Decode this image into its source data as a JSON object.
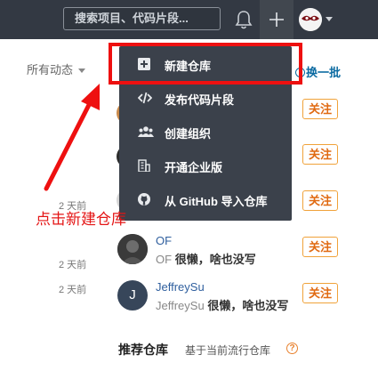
{
  "header": {
    "search_placeholder": "搜索项目、代码片段...",
    "icons": [
      "bell-icon",
      "plus-icon",
      "user-avatar",
      "chevron-down-icon"
    ],
    "colors": {
      "background": "#333943",
      "active_button": "#41474f"
    }
  },
  "feed": {
    "filter_label": "所有动态",
    "refresh_label": "换一批",
    "follow_label": "关注",
    "times": [
      "2 天前",
      "2 天前",
      "2 天前"
    ],
    "users": [
      {
        "name": "OF",
        "bio_name": "OF",
        "bio_text": "很懒，啥也没写"
      },
      {
        "name": "JeffreySu",
        "bio_name": "JeffreySu",
        "bio_text": "很懒，啥也没写",
        "initial": "J"
      }
    ]
  },
  "dropdown_menu": {
    "items": [
      {
        "label": "新建仓库",
        "icon": "plus-square-icon"
      },
      {
        "label": "发布代码片段",
        "icon": "code-icon"
      },
      {
        "label": "创建组织",
        "icon": "group-icon"
      },
      {
        "label": "开通企业版",
        "icon": "building-icon"
      },
      {
        "label": "从 GitHub 导入仓库",
        "icon": "github-icon"
      }
    ],
    "colors": {
      "background": "#3b414b",
      "text": "#ffffff"
    }
  },
  "recommend": {
    "title": "推荐仓库",
    "subtitle": "基于当前流行仓库"
  },
  "annotation": {
    "text": "点击新建仓库",
    "color": "#e41515"
  },
  "colors": {
    "follow_border": "#f0a23a",
    "follow_text": "#e06a12",
    "link": "#0a6aa1"
  }
}
